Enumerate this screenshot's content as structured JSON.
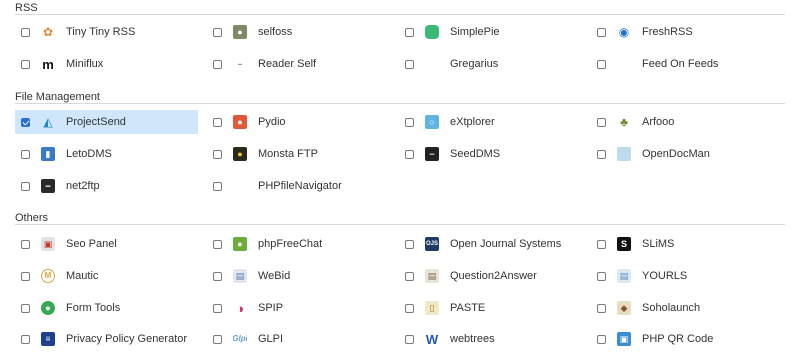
{
  "sections": {
    "rss": {
      "title": "RSS",
      "items": [
        {
          "label": "Tiny Tiny RSS",
          "checked": false,
          "icon": "tinytinyrss-icon"
        },
        {
          "label": "selfoss",
          "checked": false,
          "icon": "selfoss-icon"
        },
        {
          "label": "SimplePie",
          "checked": false,
          "icon": "simplepie-icon"
        },
        {
          "label": "FreshRSS",
          "checked": false,
          "icon": "freshrss-icon"
        },
        {
          "label": "Miniflux",
          "checked": false,
          "icon": "miniflux-icon"
        },
        {
          "label": "Reader Self",
          "checked": false,
          "icon": "readerself-icon"
        },
        {
          "label": "Gregarius",
          "checked": false,
          "icon": ""
        },
        {
          "label": "Feed On Feeds",
          "checked": false,
          "icon": ""
        }
      ]
    },
    "file_management": {
      "title": "File Management",
      "items": [
        {
          "label": "ProjectSend",
          "checked": true,
          "icon": "projectsend-icon"
        },
        {
          "label": "Pydio",
          "checked": false,
          "icon": "pydio-icon"
        },
        {
          "label": "eXtplorer",
          "checked": false,
          "icon": "extplorer-icon"
        },
        {
          "label": "Arfooo",
          "checked": false,
          "icon": "arfooo-icon"
        },
        {
          "label": "LetoDMS",
          "checked": false,
          "icon": "letodms-icon"
        },
        {
          "label": "Monsta FTP",
          "checked": false,
          "icon": "monstaftp-icon"
        },
        {
          "label": "SeedDMS",
          "checked": false,
          "icon": "seeddms-icon"
        },
        {
          "label": "OpenDocMan",
          "checked": false,
          "icon": "opendocman-icon"
        },
        {
          "label": "net2ftp",
          "checked": false,
          "icon": "net2ftp-icon"
        },
        {
          "label": "PHPfileNavigator",
          "checked": false,
          "icon": ""
        }
      ]
    },
    "others": {
      "title": "Others",
      "items": [
        {
          "label": "Seo Panel",
          "checked": false,
          "icon": "seopanel-icon"
        },
        {
          "label": "phpFreeChat",
          "checked": false,
          "icon": "phpfreechat-icon"
        },
        {
          "label": "Open Journal Systems",
          "checked": false,
          "icon": "ojs-icon"
        },
        {
          "label": "SLiMS",
          "checked": false,
          "icon": "slims-icon"
        },
        {
          "label": "Mautic",
          "checked": false,
          "icon": "mautic-icon"
        },
        {
          "label": "WeBid",
          "checked": false,
          "icon": "webid-icon"
        },
        {
          "label": "Question2Answer",
          "checked": false,
          "icon": "question2answer-icon"
        },
        {
          "label": "YOURLS",
          "checked": false,
          "icon": "yourls-icon"
        },
        {
          "label": "Form Tools",
          "checked": false,
          "icon": "formtools-icon"
        },
        {
          "label": "SPIP",
          "checked": false,
          "icon": "spip-icon"
        },
        {
          "label": "PASTE",
          "checked": false,
          "icon": "paste-icon"
        },
        {
          "label": "Soholaunch",
          "checked": false,
          "icon": "soholaunch-icon"
        },
        {
          "label": "Privacy Policy Generator",
          "checked": false,
          "icon": "privacypolicygenerator-icon"
        },
        {
          "label": "GLPI",
          "checked": false,
          "icon": "glpi-icon"
        },
        {
          "label": "webtrees",
          "checked": false,
          "icon": "webtrees-icon"
        },
        {
          "label": "PHP QR Code",
          "checked": false,
          "icon": "phpqrcode-icon"
        }
      ]
    }
  },
  "colors": {
    "selected_bg": "#cfe6fb",
    "checkbox_checked": "#2a6fd6"
  }
}
